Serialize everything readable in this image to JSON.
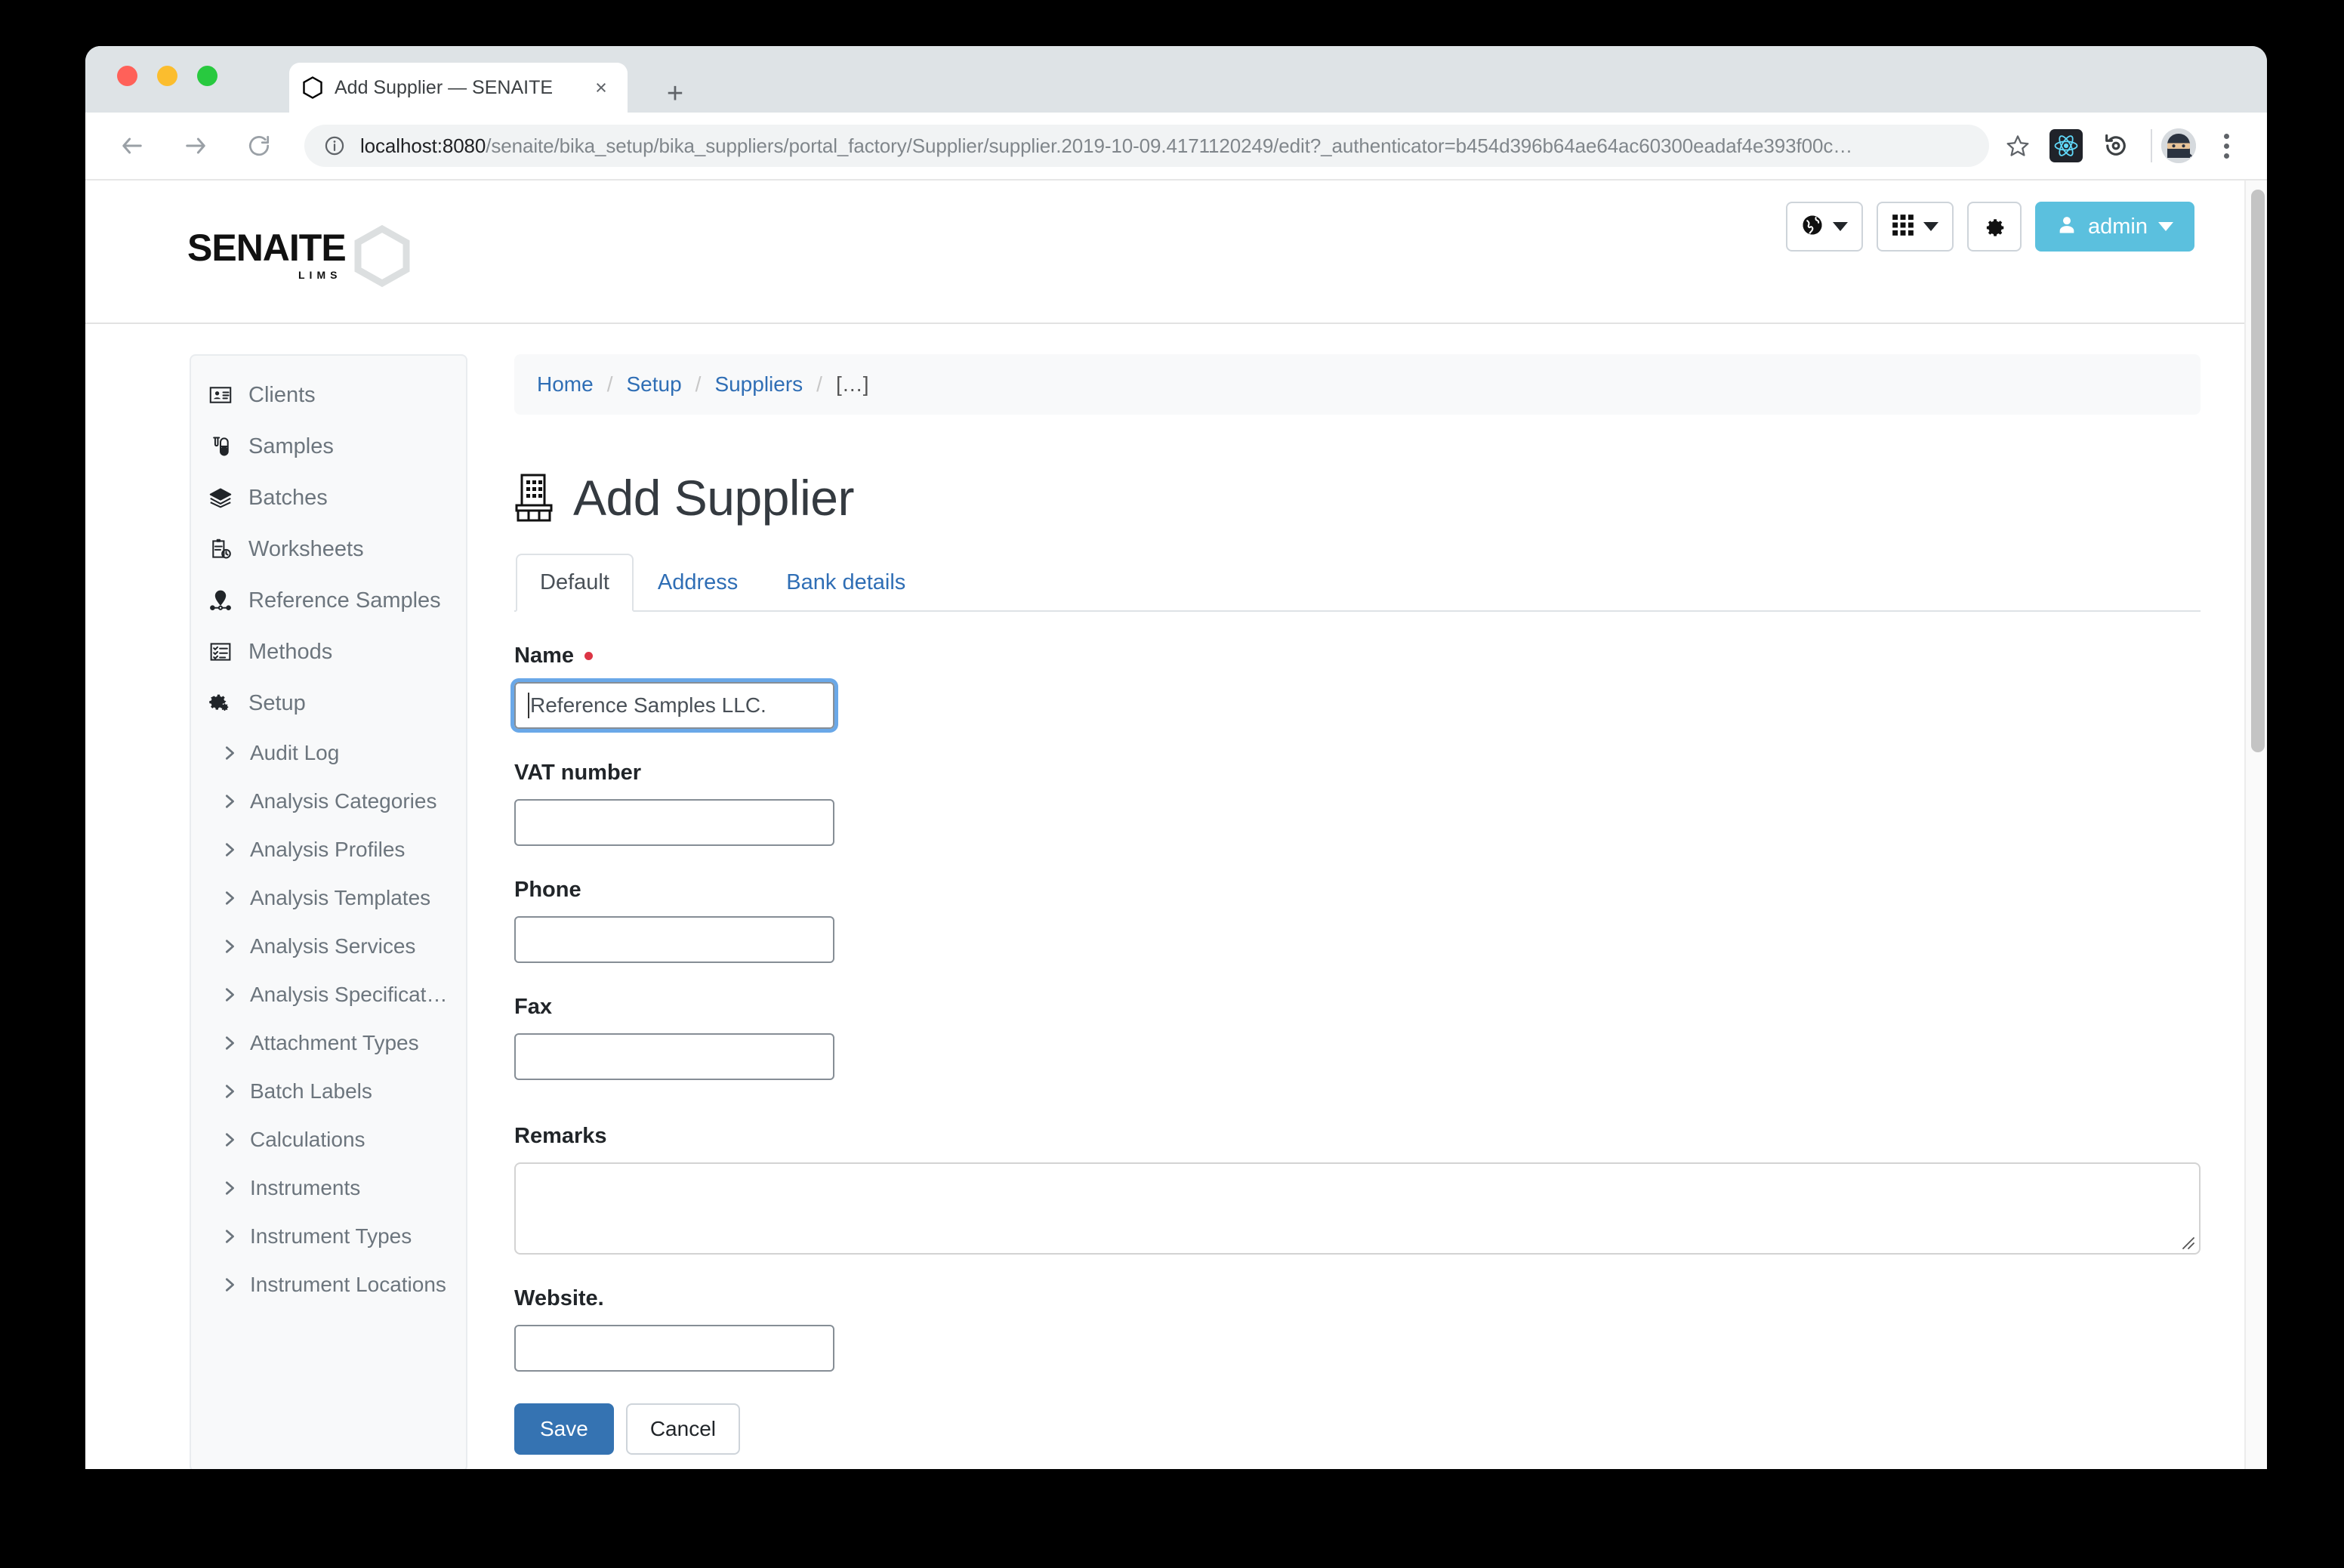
{
  "browser": {
    "tab": {
      "title": "Add Supplier — SENAITE",
      "favicon": "hexagon-icon",
      "close_label": "×"
    },
    "new_tab_label": "+",
    "nav": {
      "back_icon": "arrow-left-icon",
      "forward_icon": "arrow-right-icon",
      "reload_icon": "reload-icon"
    },
    "omnibox": {
      "site_info_icon": "info-circle-icon",
      "url_host": "localhost:8080",
      "url_path": "/senaite/bika_setup/bika_suppliers/portal_factory/Supplier/supplier.2019-10-09.4171120249/edit?_authenticator=b454d396b64ae64ac60300eadaf4e393f00c…",
      "bookmark_icon": "star-icon"
    },
    "extensions": [
      {
        "name": "react-devtools-icon"
      },
      {
        "name": "refresh-history-icon"
      }
    ],
    "profile_avatar": "ninja-avatar-icon",
    "menu_icon": "three-dot-menu-icon"
  },
  "header": {
    "logo_text": "SENAITE",
    "logo_subtext": "LIMS",
    "toolbar": {
      "language_button": {
        "icon": "globe-icon",
        "label": ""
      },
      "apps_button": {
        "icon": "grid-apps-icon",
        "label": ""
      },
      "settings_button": {
        "icon": "gear-icon",
        "label": ""
      },
      "user_button": {
        "icon": "user-icon",
        "label": "admin"
      }
    }
  },
  "sidebar": {
    "items": [
      {
        "label": "Clients",
        "icon": "id-card-icon"
      },
      {
        "label": "Samples",
        "icon": "test-tube-icon"
      },
      {
        "label": "Batches",
        "icon": "layers-icon"
      },
      {
        "label": "Worksheets",
        "icon": "clipboard-clock-icon"
      },
      {
        "label": "Reference Samples",
        "icon": "map-pin-icon"
      },
      {
        "label": "Methods",
        "icon": "checklist-icon"
      },
      {
        "label": "Setup",
        "icon": "cogs-icon"
      }
    ],
    "sub_items": [
      {
        "label": "Audit Log"
      },
      {
        "label": "Analysis Categories"
      },
      {
        "label": "Analysis Profiles"
      },
      {
        "label": "Analysis Templates"
      },
      {
        "label": "Analysis Services"
      },
      {
        "label": "Analysis Specificati…"
      },
      {
        "label": "Attachment Types"
      },
      {
        "label": "Batch Labels"
      },
      {
        "label": "Calculations"
      },
      {
        "label": "Instruments"
      },
      {
        "label": "Instrument Types"
      },
      {
        "label": "Instrument Locations"
      }
    ]
  },
  "breadcrumb": {
    "items": [
      {
        "label": "Home",
        "link": true
      },
      {
        "label": "Setup",
        "link": true
      },
      {
        "label": "Suppliers",
        "link": true
      },
      {
        "label": "[…]",
        "link": false
      }
    ],
    "separator": "/"
  },
  "page": {
    "title": "Add Supplier",
    "title_icon": "department-store-icon",
    "tabs": [
      {
        "label": "Default",
        "active": true
      },
      {
        "label": "Address",
        "active": false
      },
      {
        "label": "Bank details",
        "active": false
      }
    ],
    "fields": [
      {
        "label": "Name",
        "required": true,
        "value": "Reference Samples LLC.",
        "placeholder": "",
        "focused": true,
        "type": "text"
      },
      {
        "label": "VAT number",
        "required": false,
        "value": "",
        "placeholder": "",
        "focused": false,
        "type": "text"
      },
      {
        "label": "Phone",
        "required": false,
        "value": "",
        "placeholder": "",
        "focused": false,
        "type": "text"
      },
      {
        "label": "Fax",
        "required": false,
        "value": "",
        "placeholder": "",
        "focused": false,
        "type": "text"
      },
      {
        "label": "Remarks",
        "required": false,
        "value": "",
        "placeholder": "",
        "focused": false,
        "type": "textarea"
      },
      {
        "label": "Website.",
        "required": false,
        "value": "",
        "placeholder": "",
        "focused": false,
        "type": "text"
      }
    ],
    "actions": {
      "save_label": "Save",
      "cancel_label": "Cancel"
    }
  },
  "colors": {
    "brand_blue": "#5bc0de",
    "link_blue": "#2f6eb5",
    "save_blue": "#3573b2",
    "required_red": "#dc3545"
  }
}
